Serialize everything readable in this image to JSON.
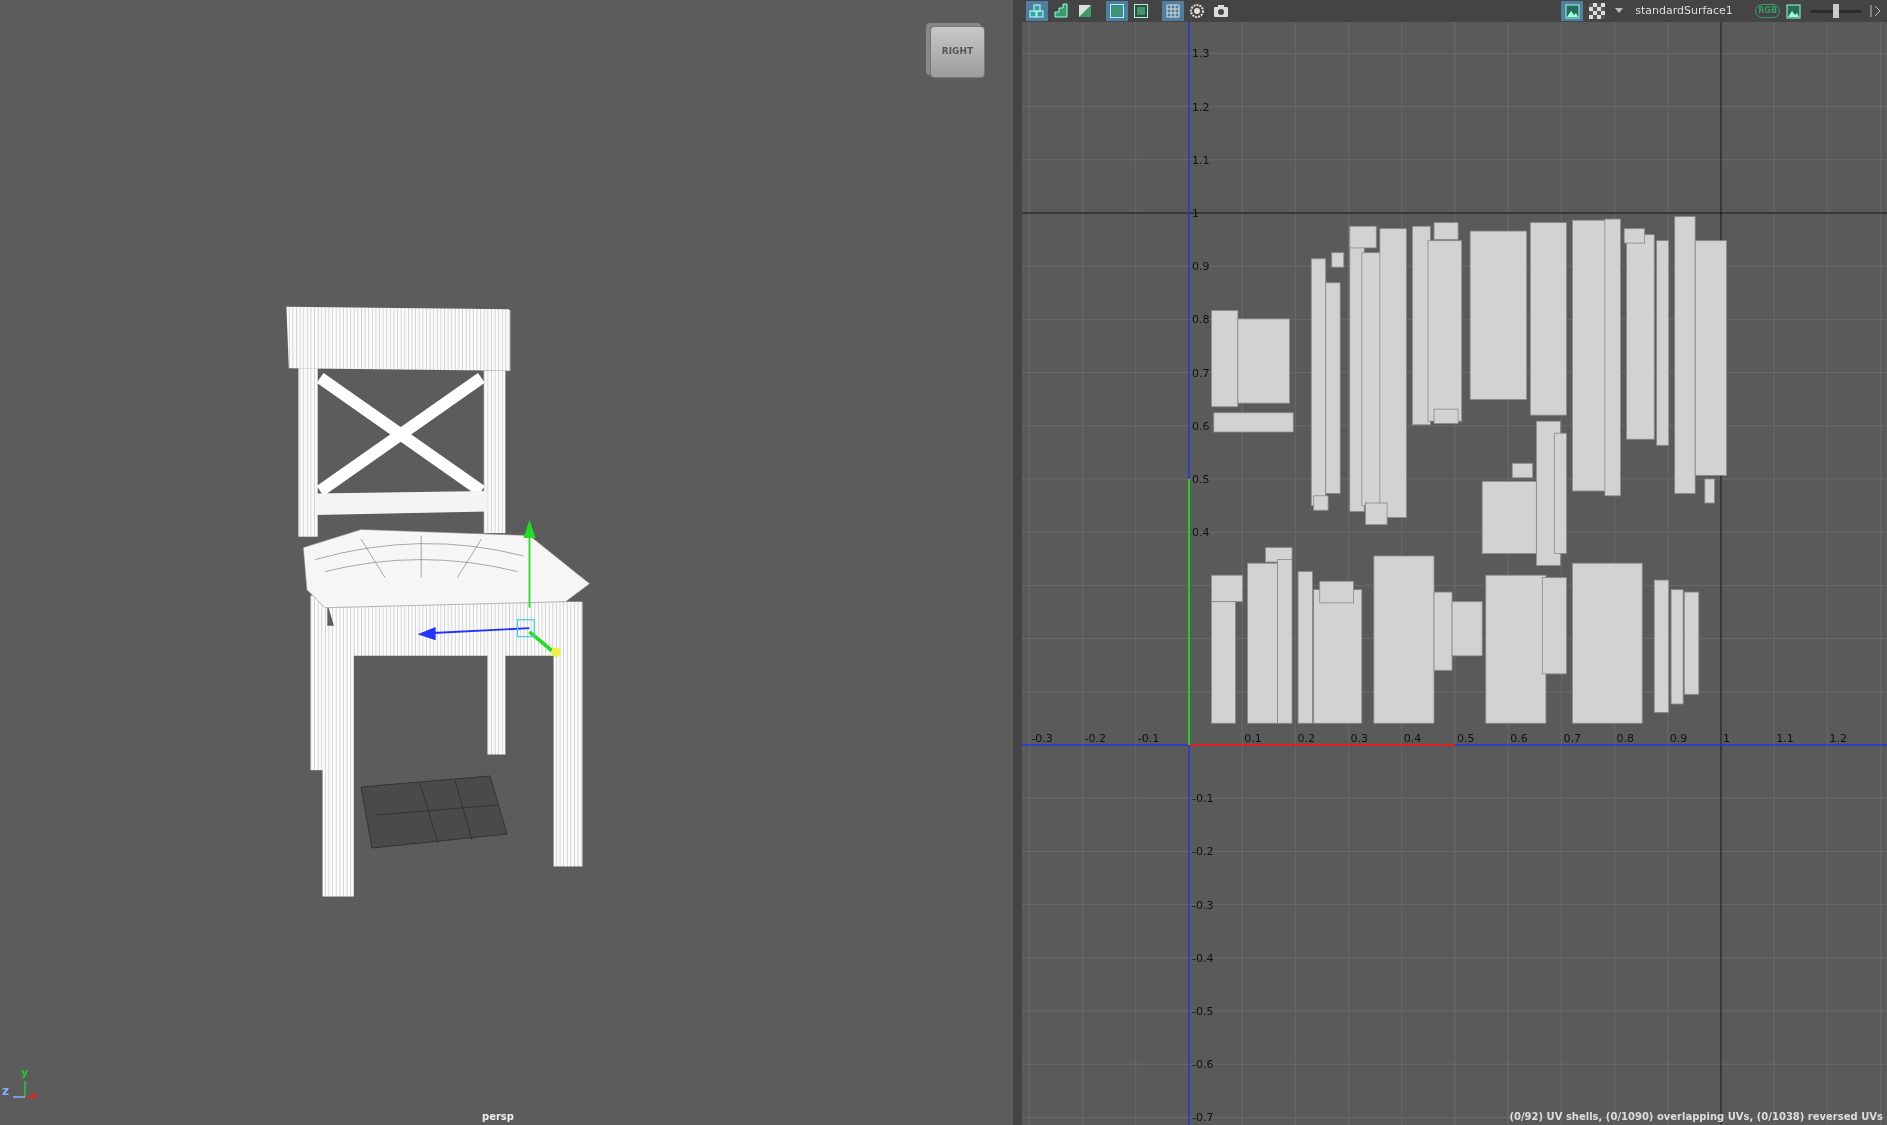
{
  "viewport": {
    "view_cube_label": "RIGHT",
    "camera": "persp",
    "axes": [
      {
        "label": "y",
        "color": "#22cc22"
      },
      {
        "label": "z",
        "color": "#8aa8ff"
      },
      {
        "label": "x",
        "color": "#ee2222"
      }
    ]
  },
  "uv_editor": {
    "toolbar": {
      "buttons": [
        {
          "kind": "stack",
          "selected": true
        },
        {
          "kind": "steps",
          "selected": false
        },
        {
          "kind": "shaded",
          "selected": false
        },
        {
          "kind": "frame",
          "selected": true
        },
        {
          "kind": "frame",
          "selected": false
        },
        {
          "kind": "grid",
          "selected": true
        },
        {
          "kind": "circle",
          "selected": false
        },
        {
          "kind": "camera",
          "selected": false
        }
      ],
      "image_button": {
        "selected": true
      },
      "shader": "standardSurface1",
      "rgb_label": "RGB",
      "exposure": {
        "level": 0.5
      }
    },
    "u_labels": [
      "-0.3",
      "-0.2",
      "-0.1",
      "0.1",
      "0.2",
      "0.3",
      "0.4",
      "0.5",
      "0.6",
      "0.7",
      "0.8",
      "0.9",
      "1",
      "1.1",
      "1.2"
    ],
    "v_labels_upper": [
      "1.3",
      "1.2",
      "1.1",
      "1",
      "0.9",
      "0.8",
      "0.7",
      "0.6",
      "0.5",
      "0.4"
    ],
    "v_labels_lower": [
      "-0.1",
      "-0.2",
      "-0.3",
      "-0.4",
      "-0.5",
      "-0.6",
      "-0.7"
    ],
    "status": "(0/92) UV shells, (0/1090) overlapping UVs, (0/1038) reversed UVs"
  }
}
